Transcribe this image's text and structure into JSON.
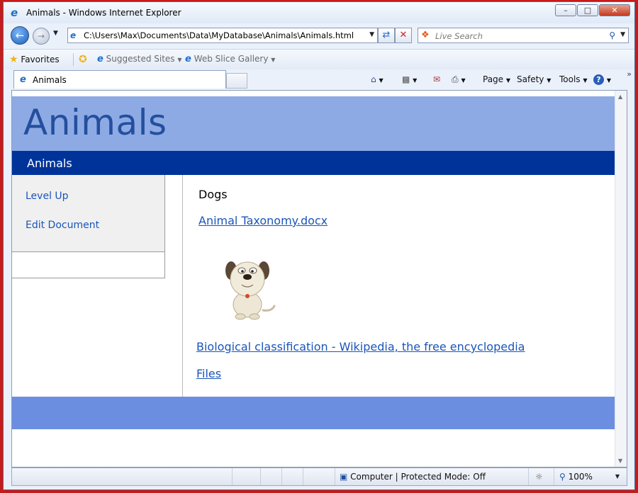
{
  "window": {
    "title": "Animals - Windows Internet Explorer",
    "minimize": "–",
    "maximize": "□",
    "close": "✕"
  },
  "address_bar": {
    "url": "C:\\Users\\Max\\Documents\\Data\\MyDatabase\\Animals\\Animals.html",
    "search_placeholder": "Live Search"
  },
  "favorites_bar": {
    "favorites": "Favorites",
    "suggested_sites": "Suggested Sites",
    "web_slice_gallery": "Web Slice Gallery"
  },
  "tabs": [
    {
      "label": "Animals",
      "active": true
    }
  ],
  "command_bar": {
    "page": "Page",
    "safety": "Safety",
    "tools": "Tools",
    "help": "?"
  },
  "page": {
    "title": "Animals",
    "nav_label": "Animals",
    "left_links": [
      "Level Up",
      "Edit Document"
    ],
    "heading": "Dogs",
    "doc_link": "Animal Taxonomy.docx",
    "wiki_link": "Biological classification - Wikipedia, the free encyclopedia",
    "files_link": "Files"
  },
  "status_bar": {
    "zone": "Computer | Protected Mode: Off",
    "zoom": "100%"
  },
  "icons": {
    "back": "back-arrow-icon",
    "forward": "forward-arrow-icon",
    "refresh": "refresh-icon",
    "stop": "stop-icon",
    "search": "magnifier-icon",
    "home": "home-icon",
    "feeds": "rss-feed-icon",
    "mail": "mail-icon",
    "print": "printer-icon",
    "help": "help-icon",
    "dog": "dog-clipart"
  },
  "colors": {
    "header_band": "#8eaae4",
    "nav_band": "#003399",
    "footer_band": "#6c8ee0",
    "link": "#1a55b8",
    "title_text": "#234f9e"
  }
}
